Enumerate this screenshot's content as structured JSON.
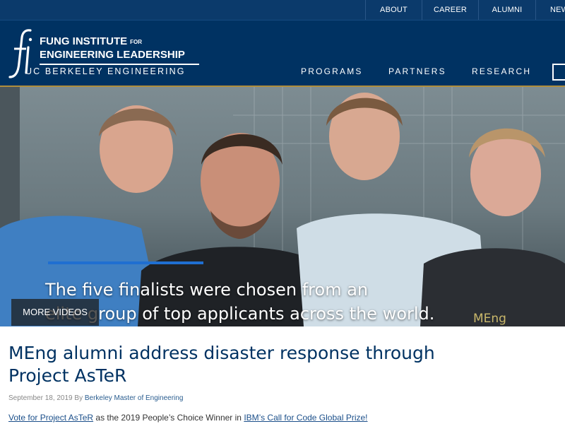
{
  "top_nav": {
    "items": [
      {
        "label": "ABOUT"
      },
      {
        "label": "CAREER"
      },
      {
        "label": "ALUMNI"
      },
      {
        "label": "NEW"
      }
    ]
  },
  "logo": {
    "glyph": "fi",
    "title_line1": "FUNG INSTITUTE",
    "title_for": "FOR",
    "title_line2": "ENGINEERING LEADERSHIP",
    "subtitle": "UC BERKELEY ENGINEERING"
  },
  "main_nav": {
    "items": [
      {
        "label": "PROGRAMS"
      },
      {
        "label": "PARTNERS"
      },
      {
        "label": "RESEARCH"
      }
    ]
  },
  "hero": {
    "caption_line1": "The five finalists were chosen from an",
    "caption_line2": "elite group of top applicants across the world.",
    "more_videos_label": "MORE VIDEOS",
    "progress_fraction": 1.0,
    "shirt_text": "MEng"
  },
  "article": {
    "title": "MEng alumni address disaster response through Project AsTeR",
    "date": "September 18, 2019",
    "by": "By",
    "author": "Berkeley Master of Engineering",
    "lead_link1": "Vote for Project AsTeR",
    "lead_mid": " as the 2019 People’s Choice Winner in ",
    "lead_link2": "IBM’s Call for Code Global Prize!"
  },
  "colors": {
    "navy": "#003262",
    "top_bar": "#0b3a6b",
    "gold_rule": "#b08d3c",
    "progress": "#1f6fd1"
  }
}
